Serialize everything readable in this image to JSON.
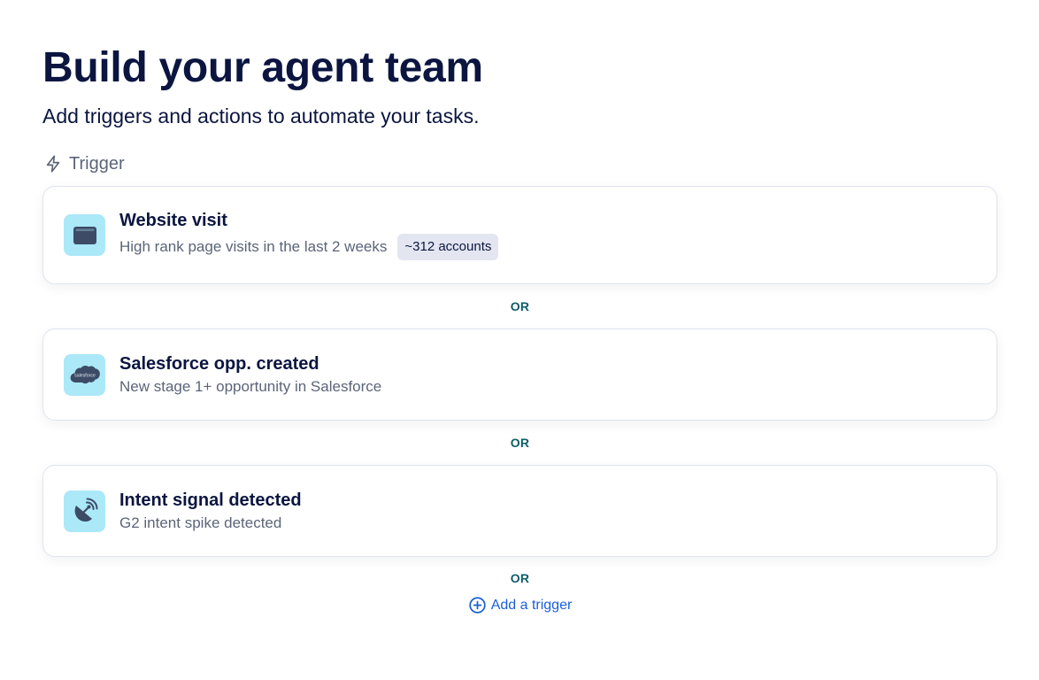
{
  "header": {
    "title": "Build your agent team",
    "subtitle": "Add triggers and actions to automate your tasks."
  },
  "section": {
    "label": "Trigger",
    "icon": "lightning-icon"
  },
  "triggers": [
    {
      "title": "Website visit",
      "description": "High rank page visits in the last 2 weeks",
      "badge": "~312 accounts",
      "icon": "browser-window-icon"
    },
    {
      "title": "Salesforce opp. created",
      "description": "New stage 1+ opportunity in Salesforce",
      "icon": "salesforce-logo-icon",
      "icon_text": "salesforce"
    },
    {
      "title": "Intent signal detected",
      "description": "G2 intent spike detected",
      "icon": "satellite-dish-icon"
    }
  ],
  "separator": {
    "label": "OR"
  },
  "add_trigger": {
    "label": "Add a trigger",
    "icon": "plus-circle-icon"
  },
  "colors": {
    "text_primary": "#0b1540",
    "text_secondary": "#5b6478",
    "icon_background": "#abe8f8",
    "icon_foreground": "#3d4b66",
    "separator_text": "#0f5d6a",
    "link": "#1b5fd6",
    "badge_background": "#e3e6f1"
  }
}
